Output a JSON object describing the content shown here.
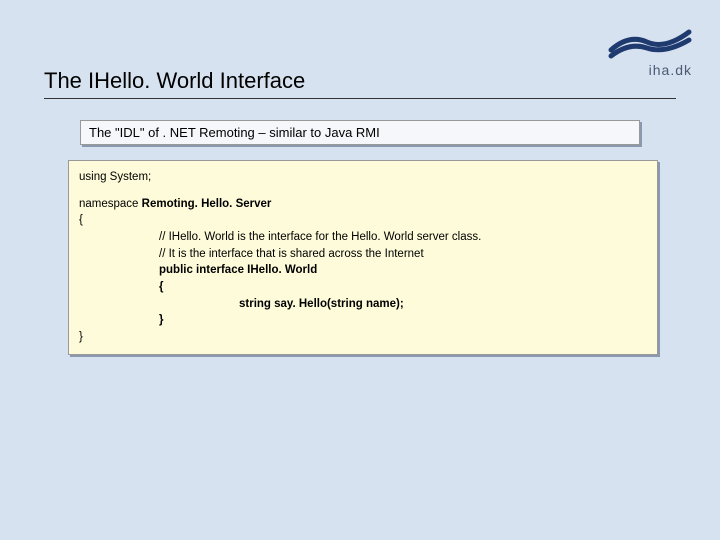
{
  "brand": {
    "text": "iha.dk"
  },
  "title": "The IHello. World Interface",
  "caption": "The \"IDL\" of . NET Remoting – similar to Java RMI",
  "code": {
    "l0": "using System;",
    "l1a": "namespace ",
    "l1b": "Remoting. Hello. Server",
    "l2": "{",
    "l3": "// IHello. World is the interface for the Hello. World server class.",
    "l4": "// It is the interface that is shared across the Internet",
    "l5": "public interface IHello. World",
    "l6": "{",
    "l7": "string say. Hello(string name);",
    "l8": "}",
    "l9": "}"
  }
}
